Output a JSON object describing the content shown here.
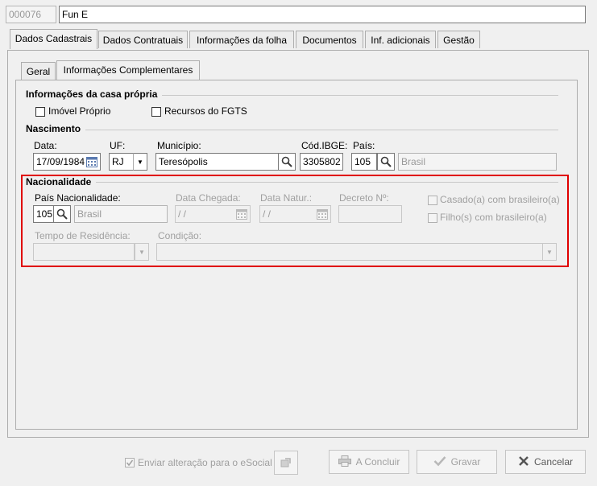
{
  "header": {
    "code": "000076",
    "name": "Fun E"
  },
  "main_tabs": [
    {
      "label": "Dados Cadastrais",
      "active": true
    },
    {
      "label": "Dados Contratuais",
      "active": false
    },
    {
      "label": "Informações da folha",
      "active": false
    },
    {
      "label": "Documentos",
      "active": false
    },
    {
      "label": "Inf. adicionais",
      "active": false
    },
    {
      "label": "Gestão",
      "active": false
    }
  ],
  "sub_tabs": [
    {
      "label": "Geral",
      "active": false
    },
    {
      "label": "Informações Complementares",
      "active": true
    }
  ],
  "casa_propria": {
    "title": "Informações da casa própria",
    "imovel_proprio": "Imóvel Próprio",
    "recursos_fgts": "Recursos do FGTS"
  },
  "nascimento": {
    "title": "Nascimento",
    "data_label": "Data:",
    "data_value": "17/09/1984",
    "uf_label": "UF:",
    "uf_value": "RJ",
    "municipio_label": "Município:",
    "municipio_value": "Teresópolis",
    "cod_ibge_label": "Cód.IBGE:",
    "cod_ibge_value": "3305802",
    "pais_label": "País:",
    "pais_code": "105",
    "pais_name": "Brasil"
  },
  "nacionalidade": {
    "title": "Nacionalidade",
    "pais_label": "País Nacionalidade:",
    "pais_code": "105",
    "pais_name": "Brasil",
    "data_chegada_label": "Data Chegada:",
    "data_chegada_value": " / /",
    "data_natur_label": "Data Natur.:",
    "data_natur_value": " / /",
    "decreto_label": "Decreto Nº:",
    "decreto_value": "",
    "casado_label": "Casado(a) com brasileiro(a)",
    "filho_label": "Filho(s) com brasileiro(a)",
    "tempo_label": "Tempo de Residência:",
    "condicao_label": "Condição:"
  },
  "footer": {
    "esocial_label": "Enviar alteração para o eSocial",
    "concluir_label": "A Concluir",
    "gravar_label": "Gravar",
    "cancelar_label": "Cancelar"
  },
  "colors": {
    "highlight_border": "#e00000"
  }
}
